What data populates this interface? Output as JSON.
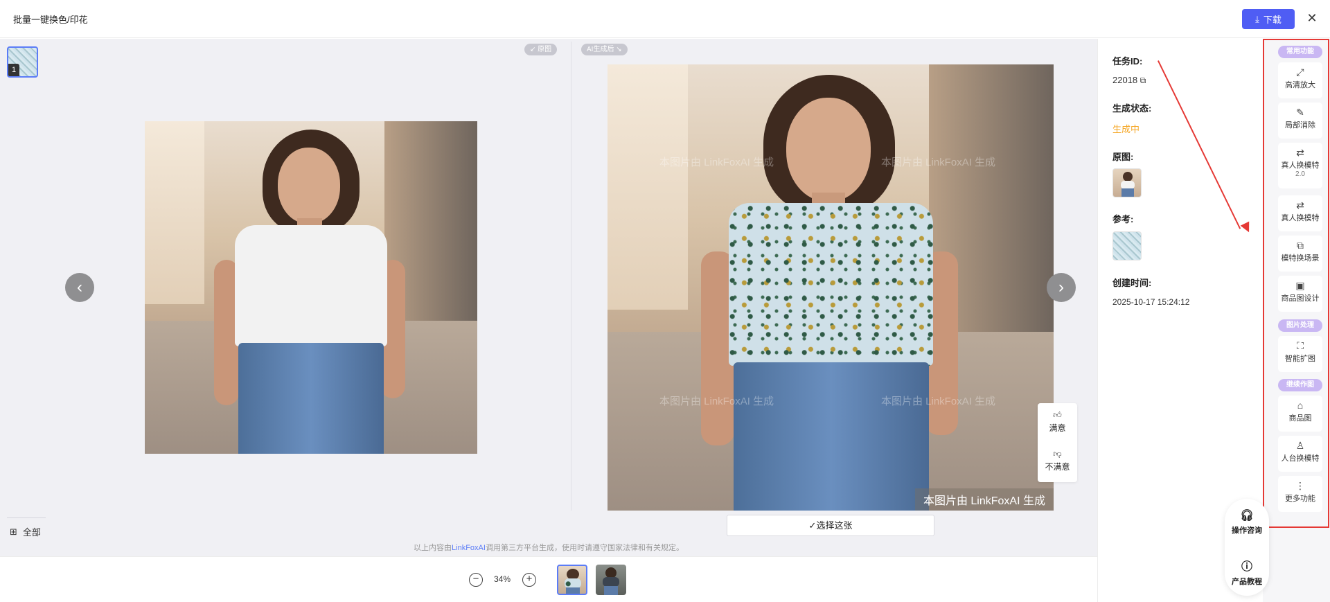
{
  "header": {
    "title": "批量一键换色/印花",
    "download_label": "下载",
    "close_icon": "close-icon"
  },
  "compare": {
    "original_tag": "↙ 原图",
    "ai_tag": "AI生成后 ↘",
    "thumb_number": "1",
    "watermark": "本图片由 LinkFoxAI 生成",
    "watermark_strong": "本图片由 LinkFoxAI 生成",
    "rate_good": "满意",
    "rate_bad": "不满意",
    "select_label": "✓选择这张",
    "all_label": "全部",
    "disclaimer_prefix": "以上内容由",
    "disclaimer_brand": "LinkFoxAI",
    "disclaimer_suffix": "调用第三方平台生成，使用时请遵守国家法律和有关规定。"
  },
  "zoom": {
    "value": "34%",
    "minus": "−",
    "plus": "+"
  },
  "info": {
    "task_id_label": "任务ID:",
    "task_id": "22018",
    "status_label": "生成状态:",
    "status": "生成中",
    "original_label": "原图:",
    "reference_label": "参考:",
    "created_label": "创建时间:",
    "created": "2025-10-17 15:24:12"
  },
  "toolbar": {
    "group_common": "常用功能",
    "group_image": "图片处理",
    "group_continue": "继续作图",
    "tools": [
      {
        "label": "高清放大",
        "icon": "upscale-icon"
      },
      {
        "label": "局部消除",
        "icon": "eraser-icon"
      },
      {
        "label": "真人换模特",
        "sub": "2.0",
        "icon": "model-swap-icon"
      },
      {
        "label": "真人换模特",
        "icon": "model-swap-icon"
      },
      {
        "label": "模特换场景",
        "icon": "scene-icon"
      },
      {
        "label": "商品图设计",
        "icon": "layout-icon"
      },
      {
        "label": "智能扩图",
        "icon": "expand-icon"
      },
      {
        "label": "商品图",
        "icon": "bag-icon"
      },
      {
        "label": "人台换模特",
        "icon": "mannequin-icon"
      },
      {
        "label": "更多功能",
        "icon": "more-icon"
      }
    ]
  },
  "float": {
    "consult": "操作咨询",
    "tutorial": "产品教程"
  },
  "colors": {
    "accent": "#4f5df4",
    "status": "#f5a623",
    "highlight": "#e53935",
    "group_tag": "#c9b7f3"
  }
}
